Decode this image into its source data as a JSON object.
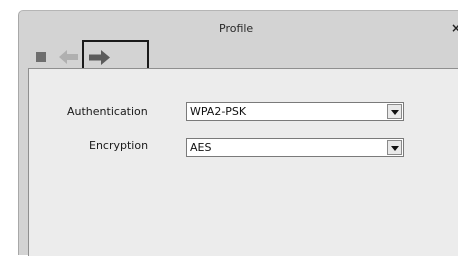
{
  "window": {
    "title": "Profile",
    "close_glyph": "×"
  },
  "toolbar": {
    "stop_icon": "stop-icon",
    "back_icon": "back-arrow-icon",
    "forward_icon": "forward-arrow-icon"
  },
  "form": {
    "authentication": {
      "label": "Authentication",
      "value": "WPA2-PSK"
    },
    "encryption": {
      "label": "Encryption",
      "value": "AES"
    }
  },
  "colors": {
    "frame": "#d3d3d3",
    "panel": "#ececec",
    "highlight_border": "#1a1a1a"
  }
}
